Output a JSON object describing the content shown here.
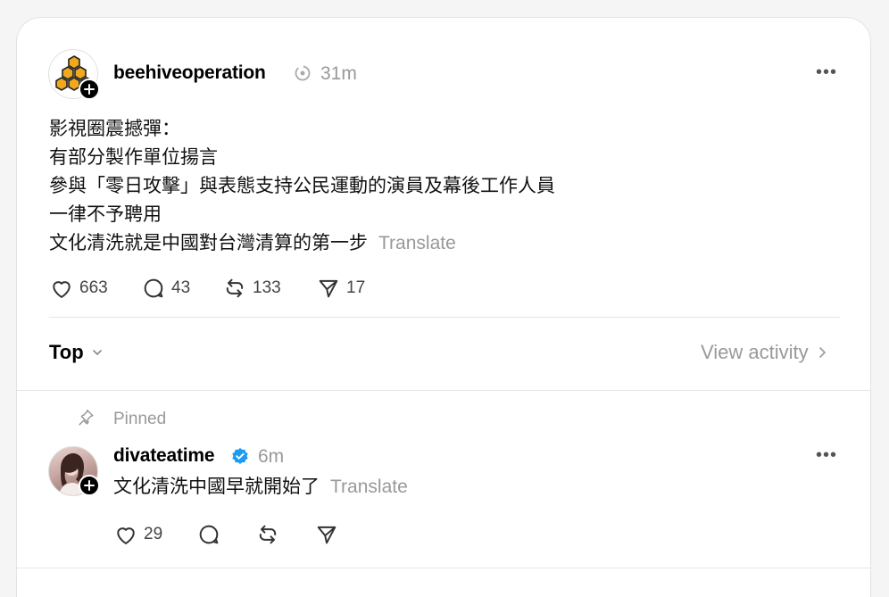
{
  "post": {
    "username": "beehiveoperation",
    "time": "31m",
    "lines": [
      "影視圈震撼彈：",
      "有部分製作單位揚言",
      "參與「零日攻擊」與表態支持公民運動的演員及幕後工作人員",
      "一律不予聘用",
      "文化清洗就是中國對台灣清算的第一步"
    ],
    "translate_label": "Translate",
    "likes": "663",
    "replies": "43",
    "reposts": "133",
    "shares": "17"
  },
  "sort": {
    "label": "Top",
    "view_activity": "View activity"
  },
  "reply": {
    "pinned_label": "Pinned",
    "username": "divateatime",
    "time": "6m",
    "text": "文化清洗中國早就開始了",
    "translate_label": "Translate",
    "likes": "29"
  },
  "colors": {
    "verified": "#1d9bf0",
    "honeycomb": "#f0a81e"
  }
}
